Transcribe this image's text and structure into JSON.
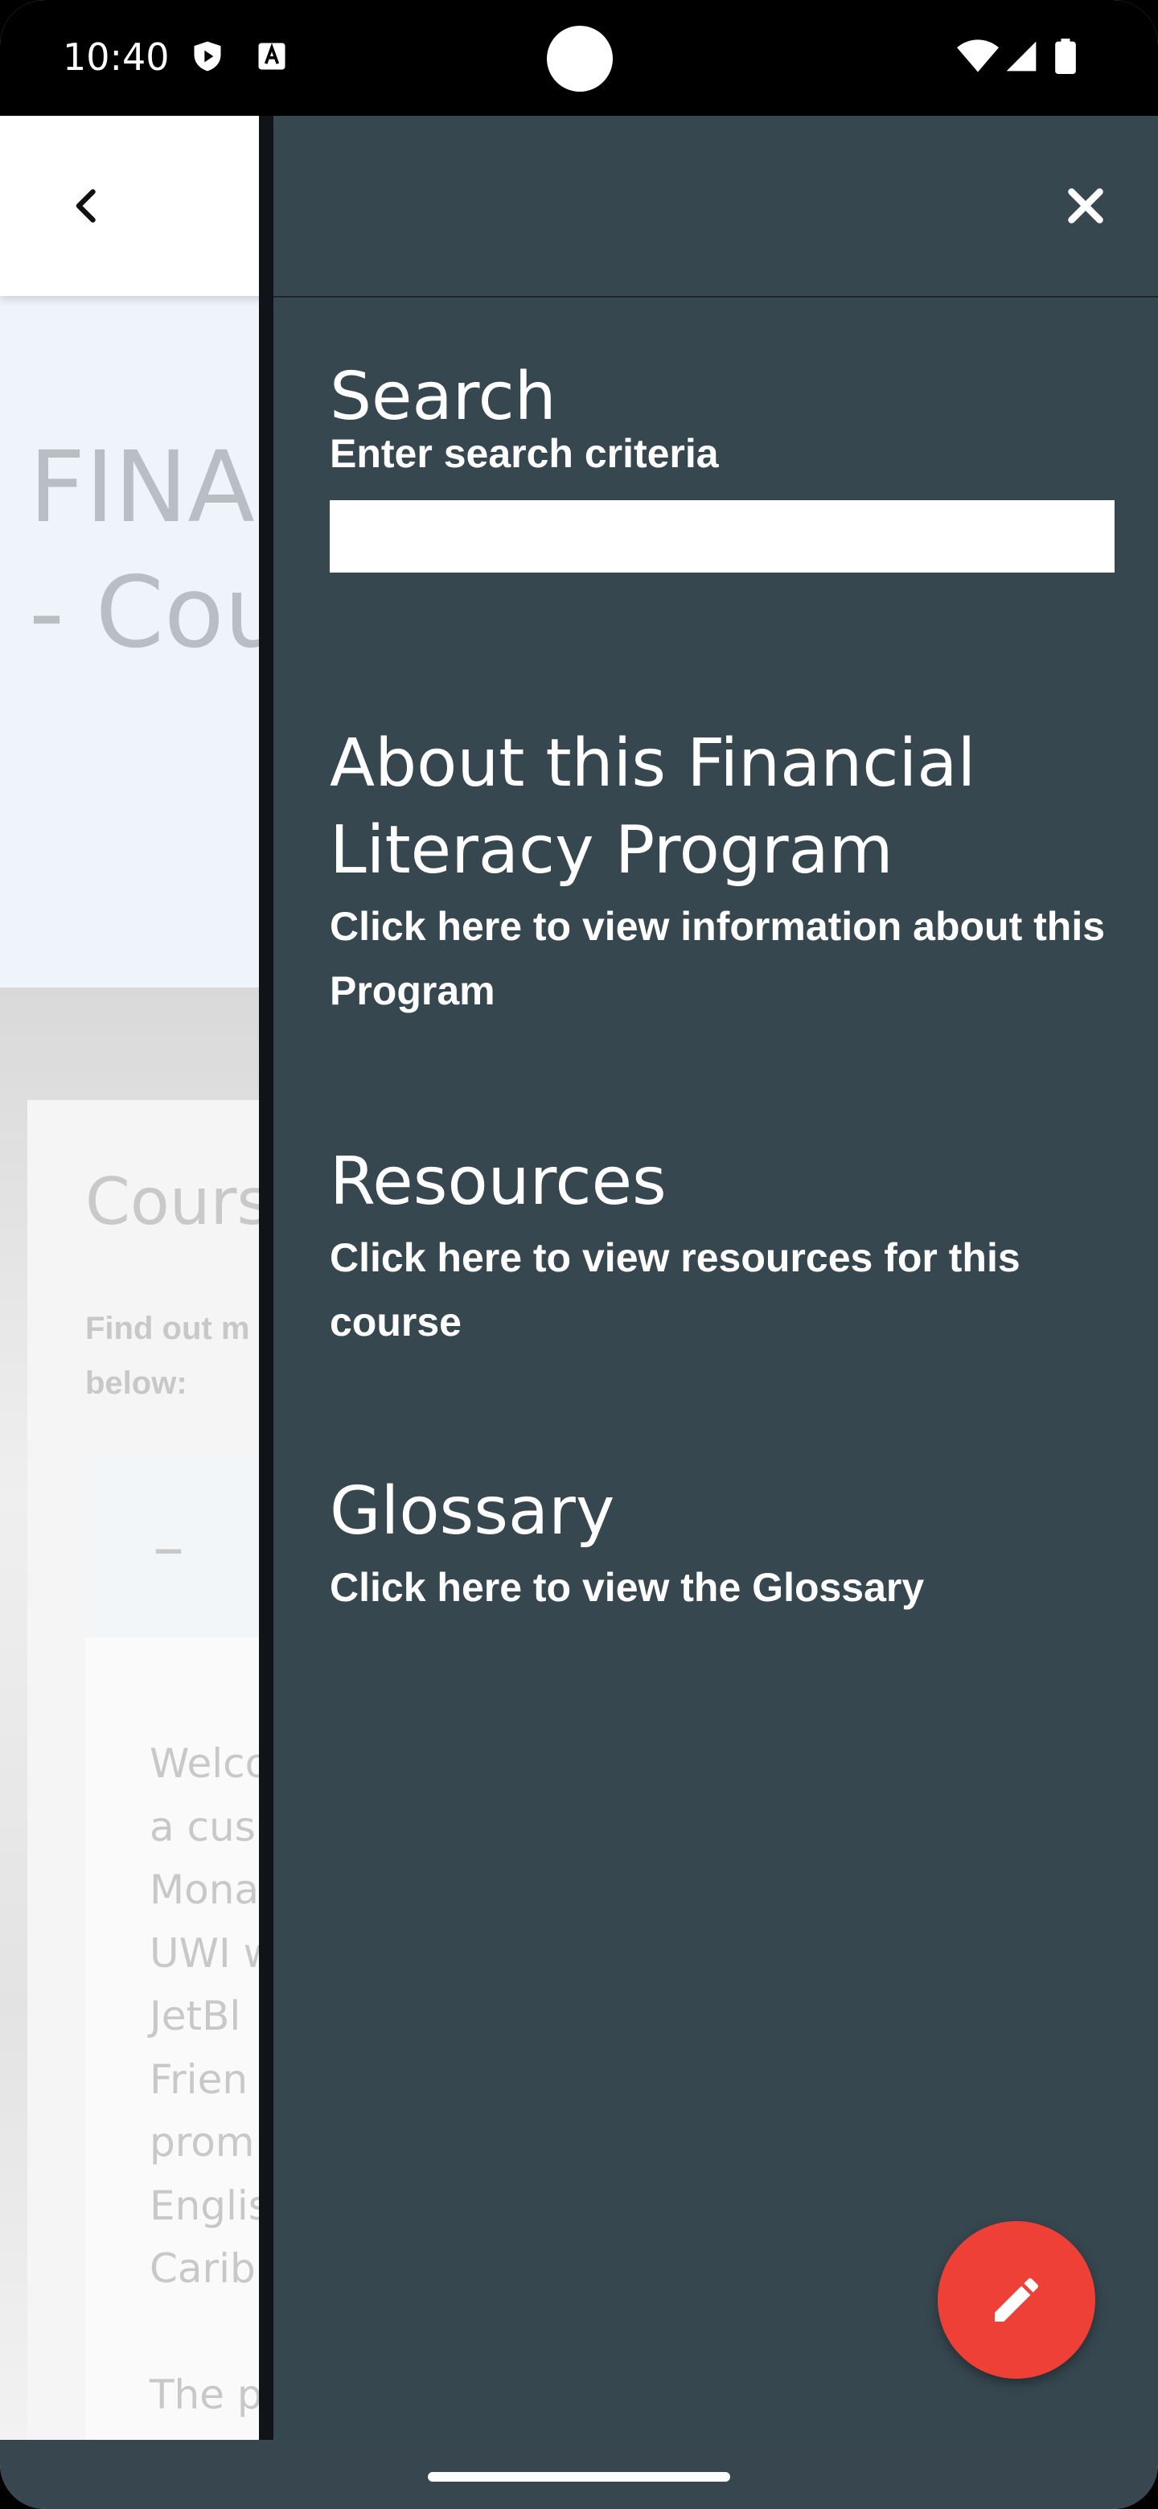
{
  "status_bar": {
    "time": "10:40",
    "icons": [
      "shield-play-icon",
      "text-a-icon",
      "wifi-icon",
      "signal-icon",
      "battery-icon"
    ]
  },
  "background_page": {
    "back_icon": "chevron-left-icon",
    "hero_title": "FINA\n- Cou",
    "card_title": "Cours",
    "card_subtitle": "Find out m\nbelow:",
    "accordion_toggle": "–",
    "accordion_body_lines": [
      "Welco",
      "a cus",
      "Mona",
      "UWI w",
      "JetBl",
      "Frien",
      "prom",
      "Englis",
      "Carib"
    ],
    "accordion_body_next": "The p"
  },
  "drawer": {
    "close_icon": "close-icon",
    "search": {
      "title": "Search",
      "subtitle": "Enter search criteria",
      "value": "",
      "placeholder": ""
    },
    "about": {
      "title": "About this Financial Literacy Program",
      "subtitle": "Click here to view information about this Program"
    },
    "resources": {
      "title": "Resources",
      "subtitle": "Click here to view resources for this course"
    },
    "glossary": {
      "title": "Glossary",
      "subtitle": "Click here to view the Glossary"
    }
  },
  "fab": {
    "icon": "pencil-icon",
    "color": "#ee4036"
  },
  "colors": {
    "drawer_bg": "#37474f",
    "status_bar": "#000000"
  }
}
